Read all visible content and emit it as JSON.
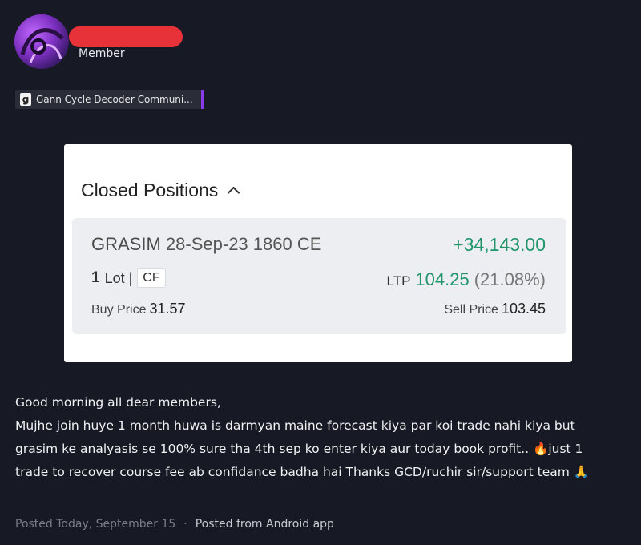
{
  "author": {
    "role": "Member"
  },
  "community_tag": {
    "icon_letter": "g",
    "label": "Gann Cycle Decoder Communi..."
  },
  "card": {
    "title": "Closed Positions",
    "position": {
      "symbol": "GRASIM",
      "contract": "28-Sep-23 1860 CE",
      "pnl": "+34,143.00",
      "qty": "1",
      "lot_label": "Lot |",
      "tag": "CF",
      "ltp_label": "LTP",
      "ltp_value": "104.25",
      "ltp_change": "(21.08%)",
      "buy_label": "Buy Price",
      "buy_value": "31.57",
      "sell_label": "Sell Price",
      "sell_value": "103.45"
    }
  },
  "post": {
    "line1": "Good morning all dear members,",
    "line2": "Mujhe join huye 1 month huwa is darmyan maine forecast kiya par koi trade nahi kiya but",
    "line3": "grasim ke analyasis se 100% sure tha 4th sep ko enter kiya aur today book profit.. 🔥just 1",
    "line4": "trade to recover course fee ab confidance badha hai Thanks GCD/ruchir sir/support team 🙏"
  },
  "footer": {
    "posted": "Posted Today, September 15",
    "separator": "·",
    "source": "Posted from Android app"
  },
  "colors": {
    "background": "#171a24",
    "profit": "#21946a",
    "accent": "#8a3ae6",
    "redaction": "#e8323a"
  }
}
